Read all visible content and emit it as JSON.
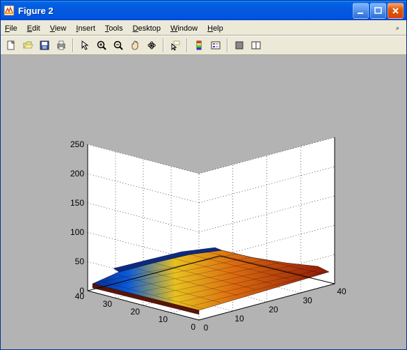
{
  "window": {
    "title": "Figure 2"
  },
  "menu": {
    "file": {
      "hot": "F",
      "rest": "ile"
    },
    "edit": {
      "hot": "E",
      "rest": "dit"
    },
    "view": {
      "hot": "V",
      "rest": "iew"
    },
    "insert": {
      "hot": "I",
      "rest": "nsert"
    },
    "tools": {
      "hot": "T",
      "rest": "ools"
    },
    "desktop": {
      "hot": "D",
      "rest": "esktop"
    },
    "window": {
      "hot": "W",
      "rest": "indow"
    },
    "help": {
      "hot": "H",
      "rest": "elp"
    }
  },
  "toolbar_icons": {
    "new": "new-figure-icon",
    "open": "open-file-icon",
    "save": "save-icon",
    "print": "print-icon",
    "pointer": "edit-plot-icon",
    "zoom_in": "zoom-in-icon",
    "zoom_out": "zoom-out-icon",
    "pan": "pan-icon",
    "rotate": "rotate-3d-icon",
    "data_cursor": "data-cursor-icon",
    "colorbar": "insert-colorbar-icon",
    "legend": "insert-legend-icon",
    "hide_tools": "hide-plot-tools-icon",
    "show_tools": "show-plot-tools-icon"
  },
  "chart_data": {
    "type": "surface-3d",
    "title": "",
    "x_axis": {
      "label": "",
      "range": [
        0,
        40
      ],
      "ticks": [
        0,
        10,
        20,
        30,
        40
      ]
    },
    "y_axis": {
      "label": "",
      "range": [
        0,
        40
      ],
      "ticks": [
        0,
        10,
        20,
        30,
        40
      ]
    },
    "z_axis": {
      "label": "",
      "range": [
        0,
        250
      ],
      "ticks": [
        0,
        50,
        100,
        150,
        200,
        250
      ]
    },
    "colormap": "jet",
    "grid": true,
    "approx_surface": {
      "description": "Low surface spanning full x/y, z mostly between ~5 and ~40; slight ridge near y≈15-20 rising to ~40; drops toward 0 at y>30; a darker blue band near y≈15 indicating a dip to ~5.",
      "z_samples": {
        "y_0": [
          10,
          10,
          12,
          14,
          15,
          16,
          16,
          18,
          18
        ],
        "y_5": [
          12,
          14,
          15,
          18,
          20,
          20,
          22,
          22,
          22
        ],
        "y_10": [
          15,
          18,
          22,
          25,
          28,
          30,
          30,
          30,
          28
        ],
        "y_15": [
          10,
          8,
          8,
          6,
          6,
          6,
          8,
          8,
          8
        ],
        "y_18": [
          20,
          25,
          30,
          35,
          38,
          40,
          40,
          38,
          35
        ],
        "y_20": [
          18,
          22,
          28,
          32,
          35,
          36,
          35,
          32,
          30
        ],
        "y_25": [
          15,
          18,
          20,
          22,
          24,
          25,
          25,
          24,
          22
        ],
        "y_30": [
          10,
          12,
          14,
          16,
          18,
          18,
          18,
          16,
          14
        ],
        "y_35": [
          5,
          6,
          8,
          8,
          10,
          10,
          10,
          8,
          6
        ],
        "y_40": [
          2,
          2,
          2,
          3,
          3,
          3,
          3,
          2,
          2
        ]
      },
      "x_sample_points": [
        0,
        5,
        10,
        15,
        20,
        25,
        30,
        35,
        40
      ]
    }
  },
  "tick_labels": {
    "z": {
      "0": "0",
      "50": "50",
      "100": "100",
      "150": "150",
      "200": "200",
      "250": "250"
    },
    "x": {
      "0": "0",
      "10": "10",
      "20": "20",
      "30": "30",
      "40": "40"
    },
    "y": {
      "0": "0",
      "10": "10",
      "20": "20",
      "30": "30",
      "40": "40"
    }
  }
}
